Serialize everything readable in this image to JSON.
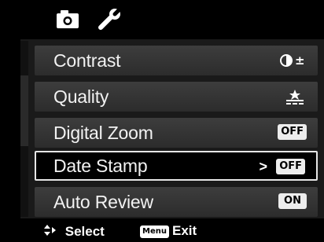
{
  "tabs": [
    {
      "icon": "camera-icon",
      "active": true
    },
    {
      "icon": "wrench-icon",
      "active": false
    }
  ],
  "menu": {
    "items": [
      {
        "label": "Contrast",
        "value_icon": "contrast-plus-minus-icon"
      },
      {
        "label": "Quality",
        "value_icon": "quality-stars-icon"
      },
      {
        "label": "Digital Zoom",
        "value": "OFF"
      },
      {
        "label": "Date Stamp",
        "value": "OFF",
        "selected": true,
        "arrow": ">"
      },
      {
        "label": "Auto Review",
        "value": "ON"
      }
    ]
  },
  "footer": {
    "select_label": "Select",
    "menu_key": "Menu",
    "exit_label": "Exit"
  },
  "colors": {
    "background": "#000000",
    "row": "#353535",
    "badge": "#ededed",
    "text": "#ffffff"
  }
}
